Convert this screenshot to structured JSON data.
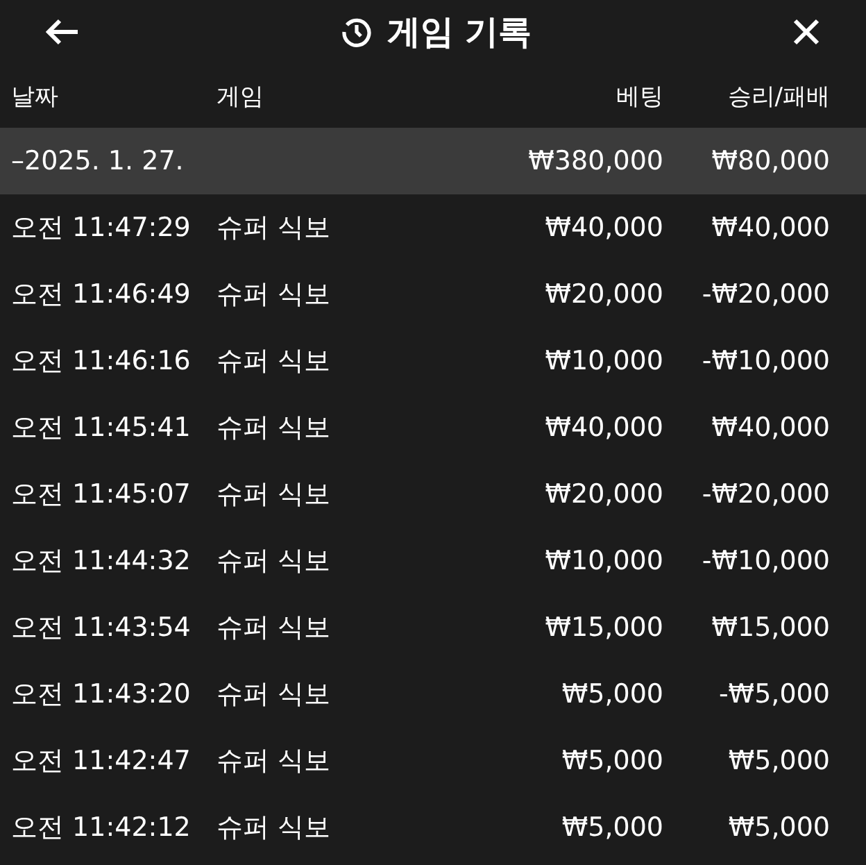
{
  "header": {
    "title": "게임 기록"
  },
  "columns": [
    "날짜",
    "게임",
    "베팅",
    "승리/패배"
  ],
  "date_group": {
    "date": "–2025. 1. 27.",
    "bet": "₩380,000",
    "result": "₩80,000"
  },
  "rows": [
    {
      "time": "오전 11:47:29",
      "game": "슈퍼 식보",
      "bet": "₩40,000",
      "result": "₩40,000"
    },
    {
      "time": "오전 11:46:49",
      "game": "슈퍼 식보",
      "bet": "₩20,000",
      "result": "-₩20,000"
    },
    {
      "time": "오전 11:46:16",
      "game": "슈퍼 식보",
      "bet": "₩10,000",
      "result": "-₩10,000"
    },
    {
      "time": "오전 11:45:41",
      "game": "슈퍼 식보",
      "bet": "₩40,000",
      "result": "₩40,000"
    },
    {
      "time": "오전 11:45:07",
      "game": "슈퍼 식보",
      "bet": "₩20,000",
      "result": "-₩20,000"
    },
    {
      "time": "오전 11:44:32",
      "game": "슈퍼 식보",
      "bet": "₩10,000",
      "result": "-₩10,000"
    },
    {
      "time": "오전 11:43:54",
      "game": "슈퍼 식보",
      "bet": "₩15,000",
      "result": "₩15,000"
    },
    {
      "time": "오전 11:43:20",
      "game": "슈퍼 식보",
      "bet": "₩5,000",
      "result": "-₩5,000"
    },
    {
      "time": "오전 11:42:47",
      "game": "슈퍼 식보",
      "bet": "₩5,000",
      "result": "₩5,000"
    },
    {
      "time": "오전 11:42:12",
      "game": "슈퍼 식보",
      "bet": "₩5,000",
      "result": "₩5,000"
    }
  ]
}
